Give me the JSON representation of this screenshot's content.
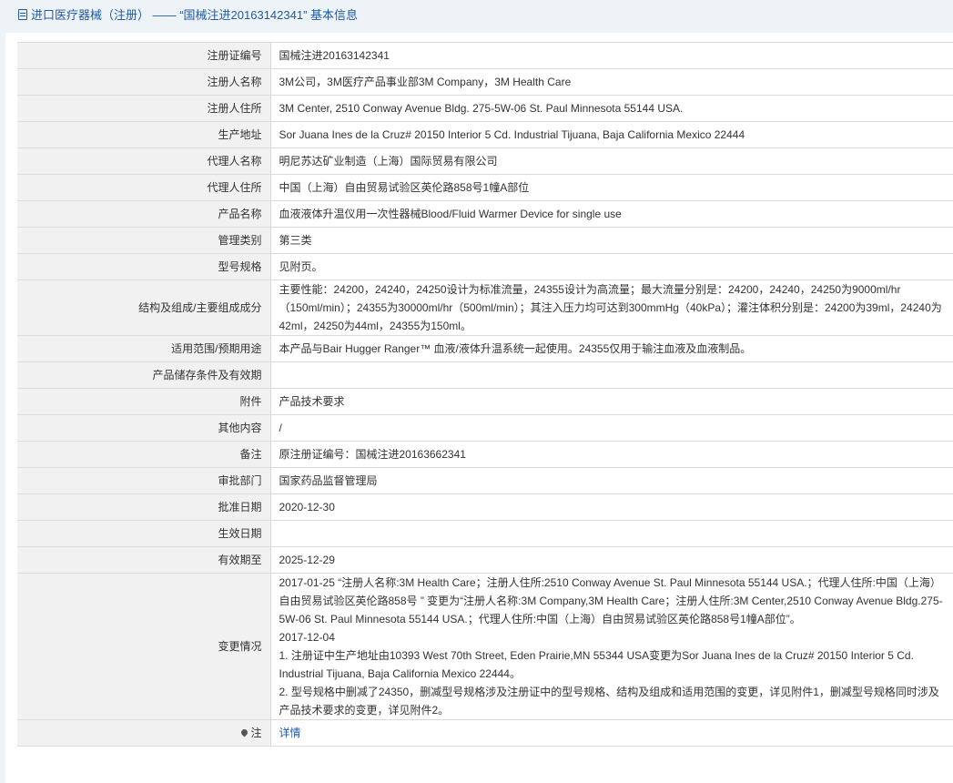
{
  "header": {
    "title": "进口医疗器械（注册） —— “国械注进20163142341” 基本信息"
  },
  "rows": [
    {
      "label": "注册证编号",
      "value": "国械注进20163142341"
    },
    {
      "label": "注册人名称",
      "value": "3M公司，3M医疗产品事业部3M Company，3M Health Care"
    },
    {
      "label": "注册人住所",
      "value": "3M Center, 2510 Conway Avenue Bldg. 275-5W-06 St. Paul Minnesota 55144 USA."
    },
    {
      "label": "生产地址",
      "value": "Sor Juana Ines de la Cruz# 20150 Interior 5 Cd. Industrial Tijuana, Baja California Mexico 22444"
    },
    {
      "label": "代理人名称",
      "value": "明尼苏达矿业制造（上海）国际贸易有限公司"
    },
    {
      "label": "代理人住所",
      "value": "中国（上海）自由贸易试验区英伦路858号1幢A部位"
    },
    {
      "label": "产品名称",
      "value": "血液液体升温仪用一次性器械Blood/Fluid Warmer Device for single use"
    },
    {
      "label": "管理类别",
      "value": "第三类"
    },
    {
      "label": "型号规格",
      "value": "见附页。"
    },
    {
      "label": "结构及组成/主要组成成分",
      "value": "主要性能：24200，24240，24250设计为标准流量，24355设计为高流量；最大流量分别是：24200，24240，24250为9000ml/hr（150ml/min）；24355为30000ml/hr（500ml/min）；其注入压力均可达到300mmHg（40kPa）；灌注体积分别是：24200为39ml，24240为42ml，24250为44ml，24355为150ml。"
    },
    {
      "label": "适用范围/预期用途",
      "value": "本产品与Bair Hugger Ranger™ 血液/液体升温系统一起使用。24355仅用于输注血液及血液制品。"
    },
    {
      "label": "产品储存条件及有效期",
      "value": ""
    },
    {
      "label": "附件",
      "value": "产品技术要求"
    },
    {
      "label": "其他内容",
      "value": "/"
    },
    {
      "label": "备注",
      "value": "原注册证编号：国械注进20163662341"
    },
    {
      "label": "审批部门",
      "value": "国家药品监督管理局"
    },
    {
      "label": "批准日期",
      "value": "2020-12-30"
    },
    {
      "label": "生效日期",
      "value": ""
    },
    {
      "label": "有效期至",
      "value": "2025-12-29"
    }
  ],
  "changes": {
    "label": "变更情况",
    "lines": [
      "2017-01-25  “注册人名称:3M Health Care；注册人住所:2510 Conway Avenue St. Paul Minnesota 55144 USA.；代理人住所:中国（上海）自由贸易试验区英伦路858号 ” 变更为“注册人名称:3M Company,3M Health Care；注册人住所:3M Center,2510 Conway Avenue Bldg.275-5W-06 St. Paul Minnesota 55144 USA.；代理人住所:中国（上海）自由贸易试验区英伦路858号1幢A部位”。",
      "2017-12-04",
      "1. 注册证中生产地址由10393 West 70th Street, Eden Prairie,MN 55344 USA变更为Sor Juana Ines de la Cruz# 20150 Interior 5 Cd. Industrial Tijuana, Baja California Mexico 22444。",
      "2. 型号规格中删减了24350，删减型号规格涉及注册证中的型号规格、结构及组成和适用范围的变更，详见附件1，删减型号规格同时涉及产品技术要求的变更，详见附件2。"
    ]
  },
  "note": {
    "label": "注",
    "link": "详情",
    "icon": "pin-icon"
  }
}
